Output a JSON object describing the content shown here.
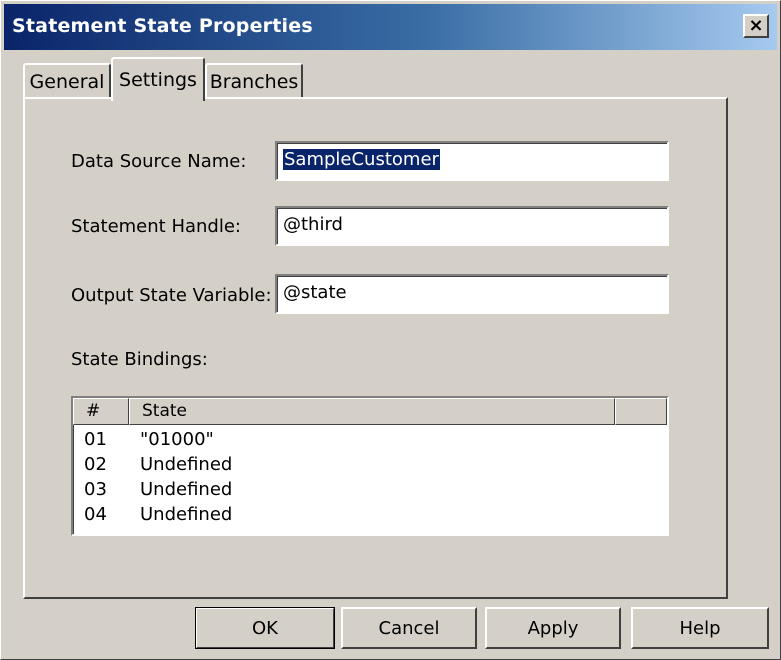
{
  "window": {
    "title": "Statement State Properties",
    "close_glyph": "×"
  },
  "tabs": [
    {
      "label": "General",
      "active": false
    },
    {
      "label": "Settings",
      "active": true
    },
    {
      "label": "Branches",
      "active": false
    }
  ],
  "settings": {
    "data_source_label": "Data Source Name:",
    "data_source_value": "SampleCustomer",
    "statement_handle_label": "Statement Handle:",
    "statement_handle_value": "@third",
    "output_state_label": "Output State Variable:",
    "output_state_value": "@state",
    "state_bindings_label": "State Bindings:"
  },
  "bindings_table": {
    "columns": [
      "#",
      "State"
    ],
    "rows": [
      {
        "num": "01",
        "state": "\"01000\""
      },
      {
        "num": "02",
        "state": "Undefined"
      },
      {
        "num": "03",
        "state": "Undefined"
      },
      {
        "num": "04",
        "state": "Undefined"
      }
    ]
  },
  "buttons": {
    "ok": "OK",
    "cancel": "Cancel",
    "apply": "Apply",
    "help": "Help"
  },
  "colors": {
    "title_start": "#0a246a",
    "title_end": "#a6caf0",
    "face": "#d4d0c8",
    "selection": "#0a246a"
  }
}
